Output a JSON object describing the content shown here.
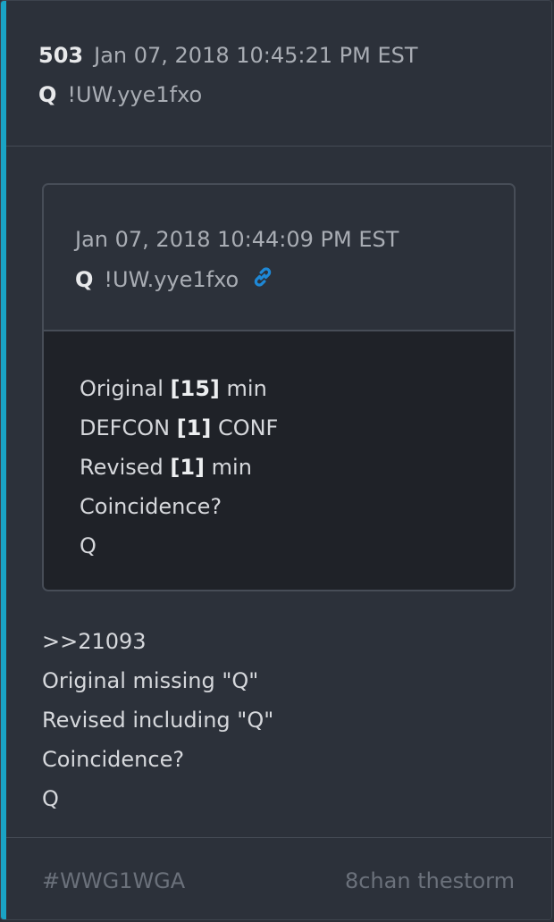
{
  "post": {
    "number": "503",
    "timestamp": "Jan 07, 2018 10:45:21 PM EST",
    "author": "Q",
    "tripcode": "!UW.yye1fxo"
  },
  "quoted": {
    "timestamp": "Jan 07, 2018 10:44:09 PM EST",
    "author": "Q",
    "tripcode": "!UW.yye1fxo",
    "link_icon": "link-icon",
    "lines": [
      {
        "pre": "Original ",
        "bold": "[15]",
        "post": " min"
      },
      {
        "pre": "DEFCON ",
        "bold": "[1]",
        "post": " CONF"
      },
      {
        "pre": "Revised ",
        "bold": "[1]",
        "post": " min"
      },
      {
        "pre": "Coincidence?",
        "bold": "",
        "post": ""
      },
      {
        "pre": "Q",
        "bold": "",
        "post": ""
      }
    ]
  },
  "reply": {
    "lines": [
      ">>21093",
      "Original missing \"Q\"",
      "Revised including \"Q\"",
      "Coincidence?",
      "Q"
    ]
  },
  "footer": {
    "hashtag": "#WWG1WGA",
    "source": "8chan thestorm"
  },
  "colors": {
    "accent": "#1aa3c4",
    "link": "#1e88d6"
  }
}
